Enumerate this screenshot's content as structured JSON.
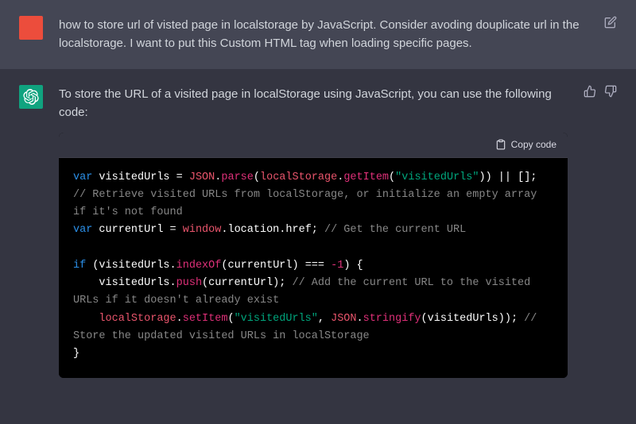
{
  "user": {
    "text": "how to store url of visted page in localstorage by JavaScript. Consider avoding douplicate url in the localstorage. I want to put this Custom HTML tag when loading specific pages."
  },
  "assistant": {
    "intro": "To store the URL of a visited page in localStorage using JavaScript, you can use the following code:"
  },
  "codeheader": {
    "copy": "Copy code"
  },
  "code": {
    "l1": {
      "kw": "var",
      "v": "visitedUrls",
      "eq": " = ",
      "o1": "JSON",
      "m1": "parse",
      "o2": "localStorage",
      "m2": "getItem",
      "s1": "\"visitedUrls\"",
      "tail": ")) || [];"
    },
    "c1": "// Retrieve visited URLs from localStorage, or initialize an empty array if it's not found",
    "l2": {
      "kw": "var",
      "v": "currentUrl",
      "eq": " = ",
      "o1": "window",
      "p1": "location",
      "p2": "href",
      "tail": ";",
      "cmt": " // Get the current URL"
    },
    "l3": {
      "kw": "if",
      "v": "visitedUrls",
      "m": "indexOf",
      "arg": "currentUrl",
      "op": " === ",
      "num": "-1",
      "tail": ") {"
    },
    "l4": {
      "indent": "    ",
      "v": "visitedUrls",
      "m": "push",
      "arg": "currentUrl",
      "tail": ");",
      "cmt": " // Add the current URL to the visited URLs if it doesn't already exist"
    },
    "l5": {
      "indent": "    ",
      "o1": "localStorage",
      "m": "setItem",
      "s1": "\"visitedUrls\"",
      "sep": ", ",
      "o2": "JSON",
      "m2": "stringify",
      "arg": "visitedUrls",
      "tail": "));",
      "cmt": " // Store the updated visited URLs in localStorage"
    },
    "l6": "}"
  }
}
